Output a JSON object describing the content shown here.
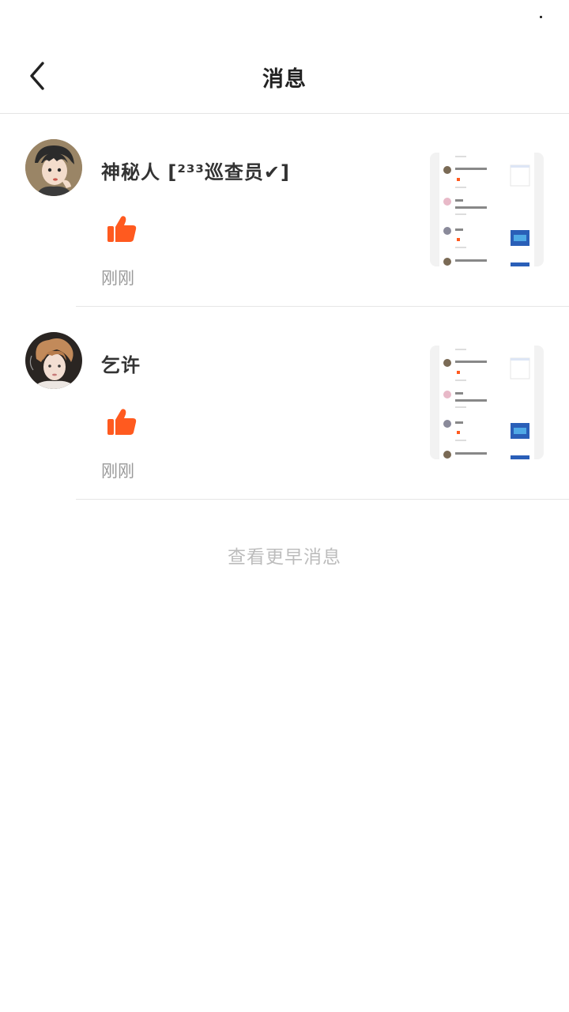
{
  "header": {
    "title": "消息"
  },
  "notifications": [
    {
      "username": "神秘人 [²³³巡查员✔]",
      "action_icon": "thumbs-up-icon",
      "time": "刚刚"
    },
    {
      "username": "乞许",
      "action_icon": "thumbs-up-icon",
      "time": "刚刚"
    }
  ],
  "footer": {
    "more_label": "查看更早消息"
  },
  "colors": {
    "accent": "#ff5a1f",
    "title": "#222222",
    "muted": "#999999",
    "link": "#bcbcbc",
    "divider": "#e6e6e6"
  }
}
